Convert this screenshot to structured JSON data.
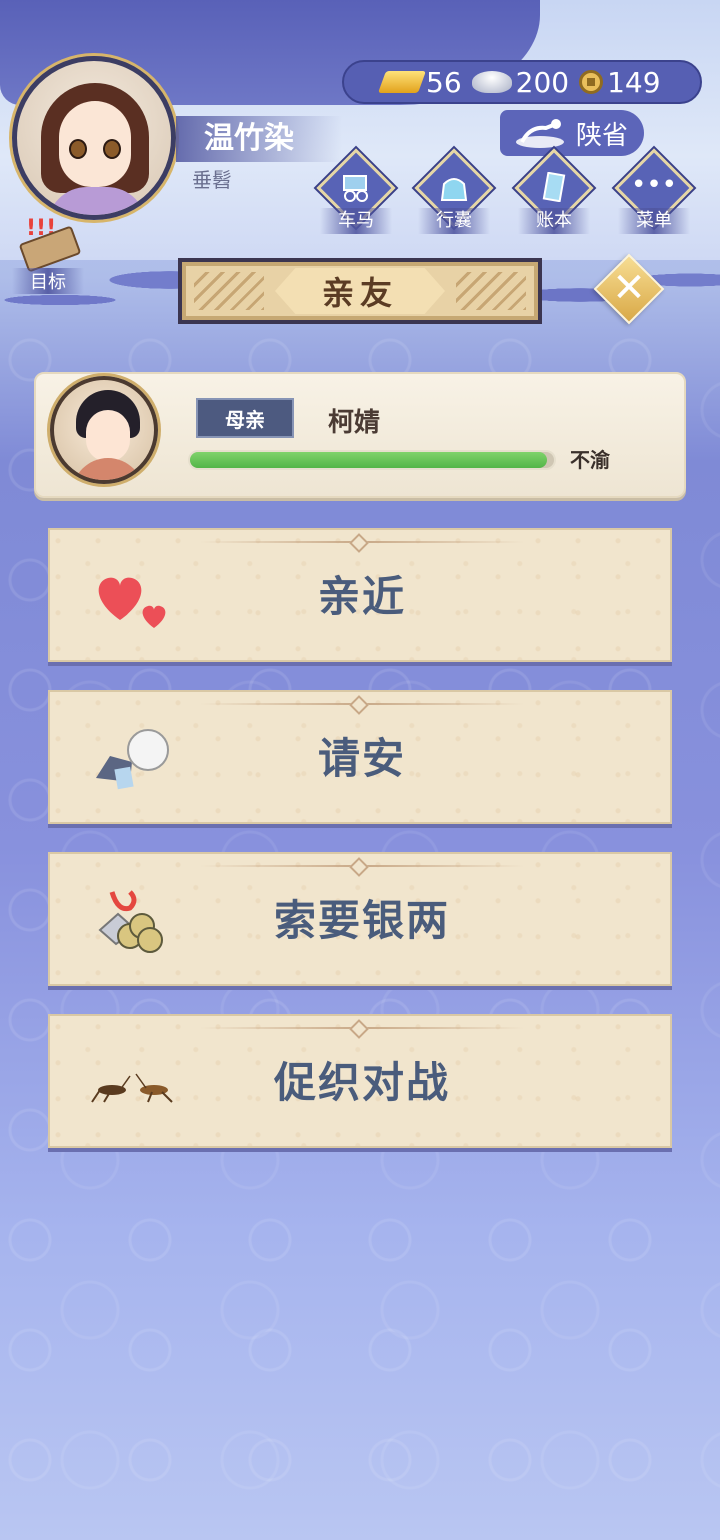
{
  "player": {
    "name": "温竹染",
    "title": "垂髫"
  },
  "currency": {
    "gold": "56",
    "silver": "200",
    "copper": "149"
  },
  "location": {
    "province": "陕省"
  },
  "menu": {
    "items": [
      {
        "label": "车马",
        "icon": "carriage-icon"
      },
      {
        "label": "行囊",
        "icon": "bag-icon"
      },
      {
        "label": "账本",
        "icon": "ledger-icon"
      },
      {
        "label": "菜单",
        "icon": "more-icon"
      }
    ],
    "more_glyph": "•••"
  },
  "goal": {
    "label": "目标",
    "badge": "!!!"
  },
  "panel": {
    "title": "亲友",
    "close_glyph": "✕"
  },
  "relative": {
    "role": "母亲",
    "name": "柯婧",
    "mood": "不渝",
    "affection": 0.98
  },
  "actions": [
    {
      "label": "亲近",
      "icon": "hearts-icon"
    },
    {
      "label": "请安",
      "icon": "bowing-icon"
    },
    {
      "label": "索要银两",
      "icon": "coins-icon"
    },
    {
      "label": "促织对战",
      "icon": "cricket-icon"
    }
  ],
  "colors": {
    "accent_blue": "#5863b6",
    "paper": "#f1e5cd",
    "progress_green": "#53b548",
    "action_text": "#4a5c7c"
  }
}
